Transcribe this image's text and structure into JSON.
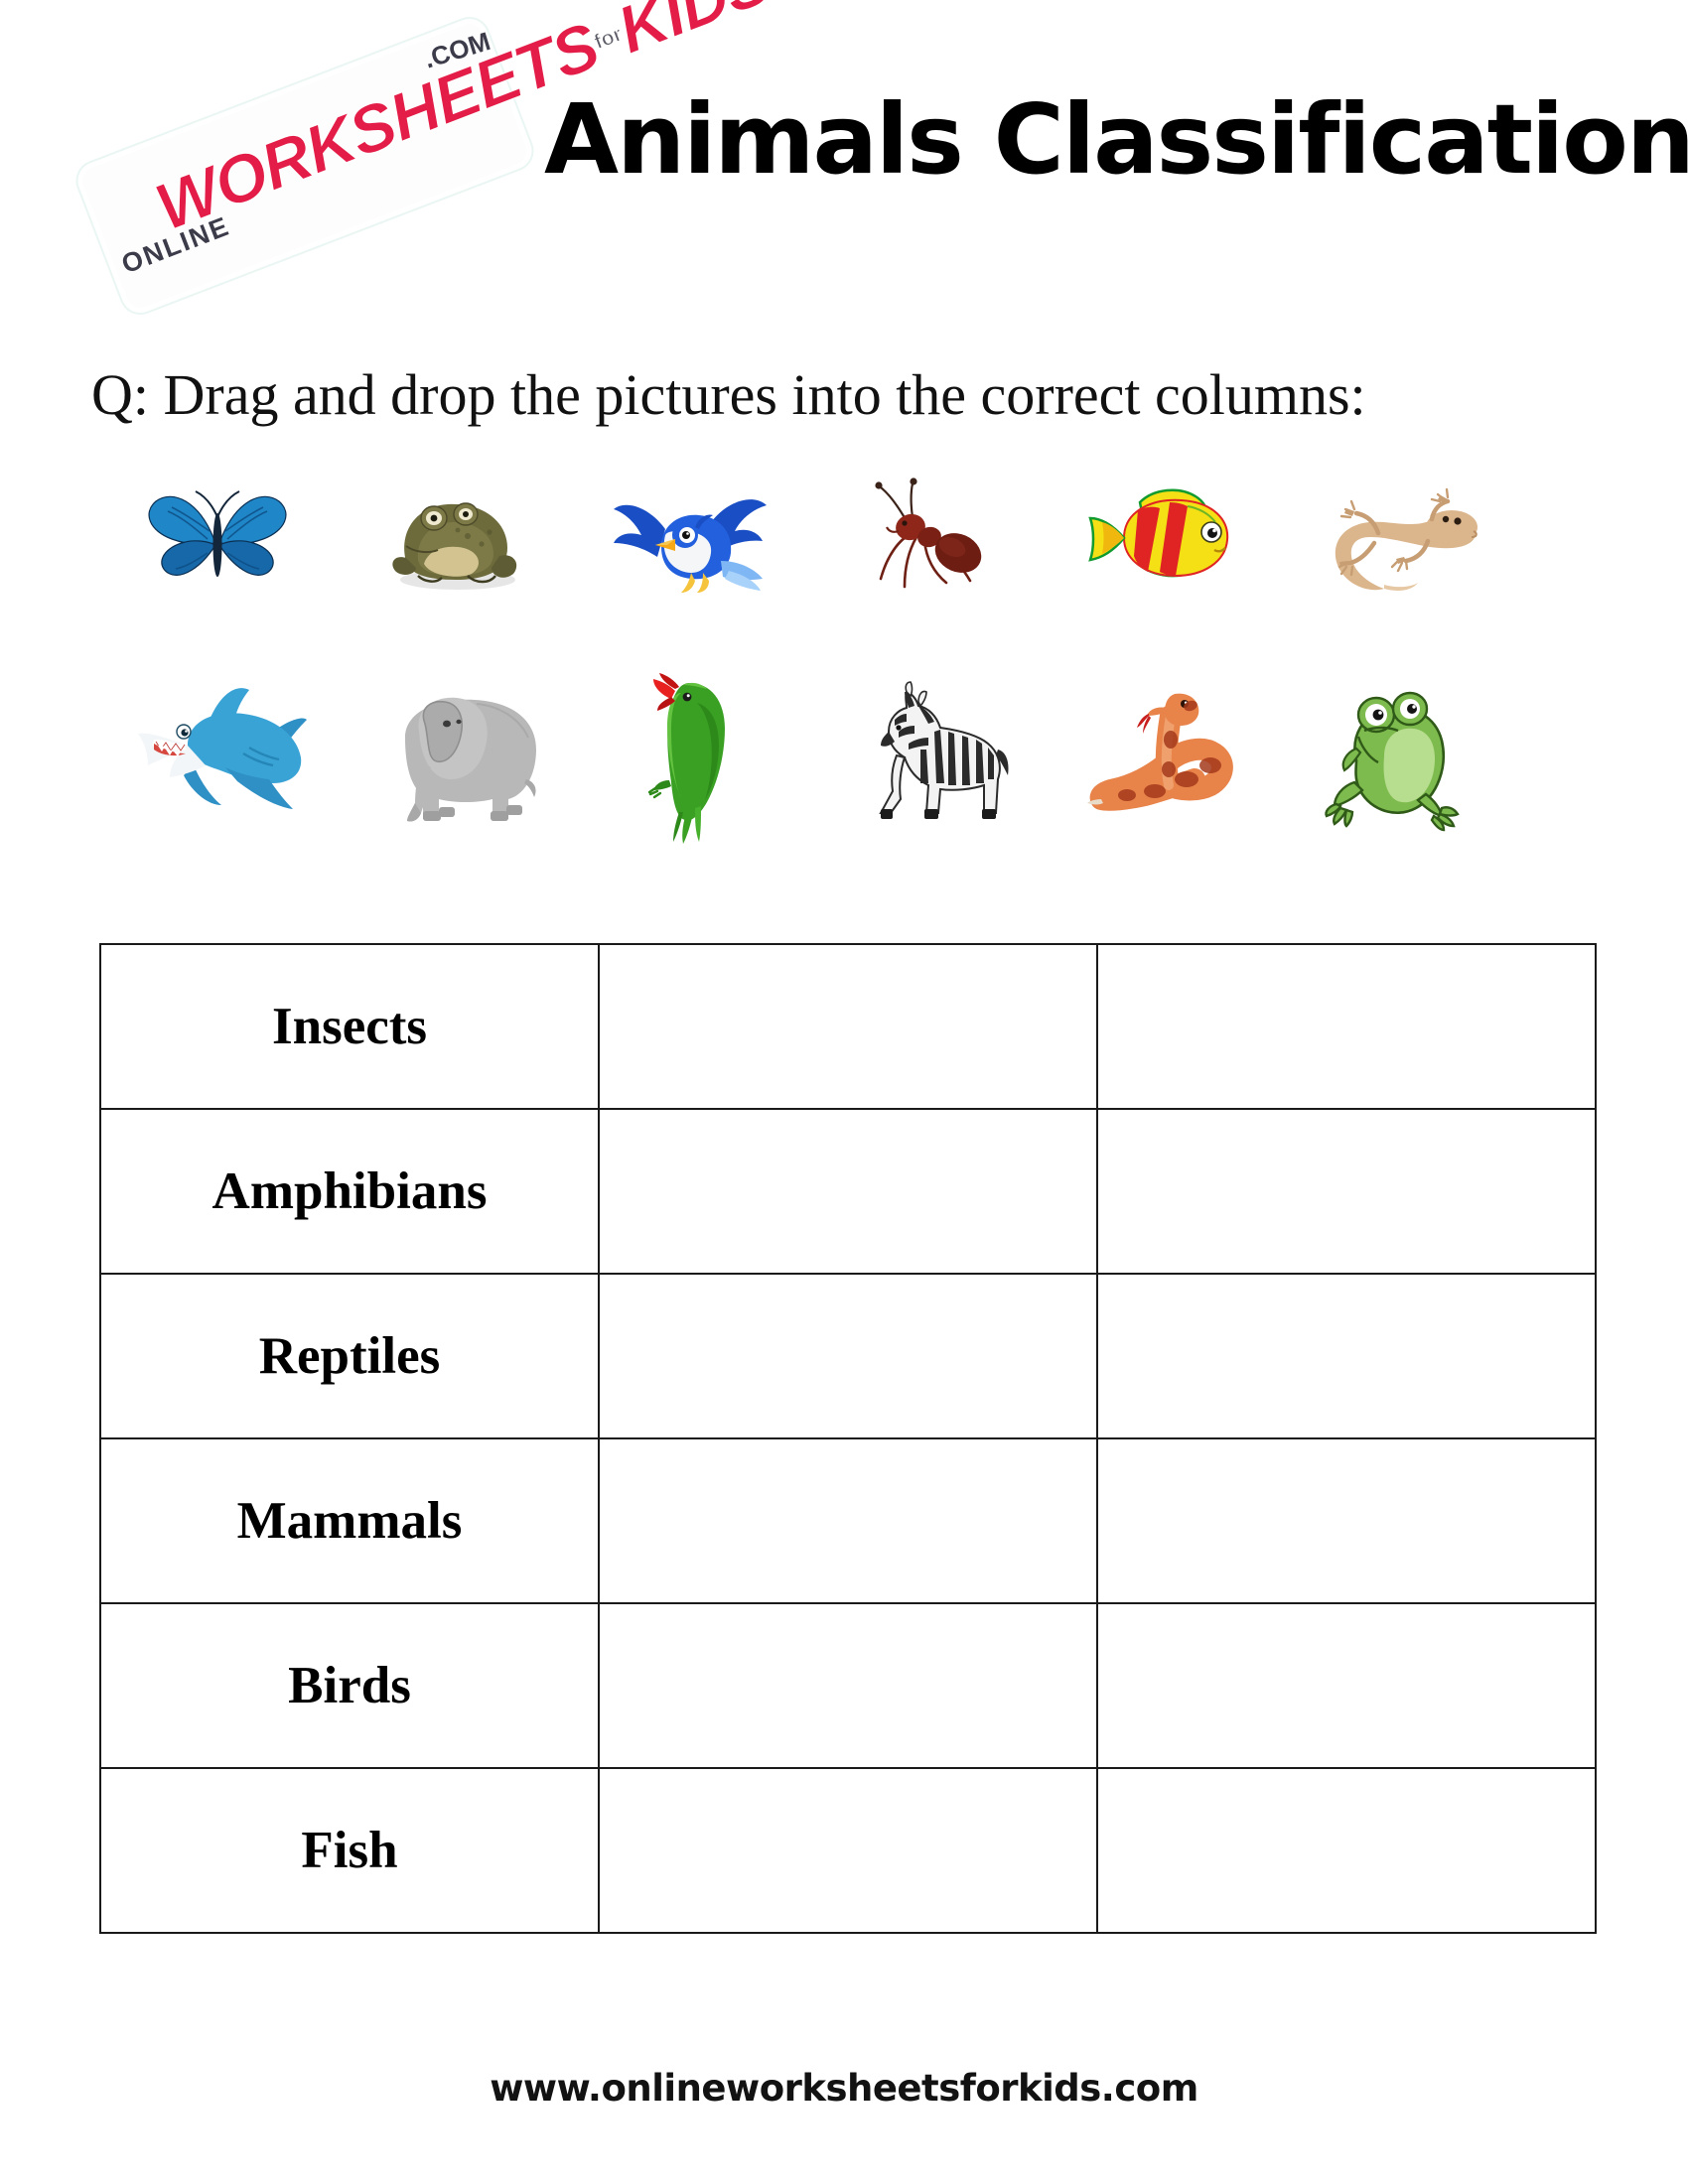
{
  "header": {
    "title": "Animals Classification",
    "logo": {
      "online": "ONLINE",
      "main": "WORKSHEETS",
      "for": "for",
      "kids": "KIDS",
      "com": ".COM",
      "accent_color": "#e31d47",
      "dark_color": "#3b3b4a"
    }
  },
  "question": "Q: Drag and drop the pictures into the correct columns:",
  "picture_bank": {
    "rows": [
      [
        {
          "name": "butterfly",
          "label": "Butterfly",
          "color": "#1f86c8"
        },
        {
          "name": "toad",
          "label": "Toad",
          "color": "#6d6b3c"
        },
        {
          "name": "bluebird",
          "label": "Blue bird",
          "color": "#1a4ec4"
        },
        {
          "name": "ant",
          "label": "Ant",
          "color": "#8e2719"
        },
        {
          "name": "clownfish",
          "label": "Fish",
          "color": "#f5e015"
        },
        {
          "name": "gecko",
          "label": "Lizard",
          "color": "#dbb58c"
        }
      ],
      [
        {
          "name": "shark",
          "label": "Shark",
          "color": "#3aa3d6"
        },
        {
          "name": "elephant",
          "label": "Elephant",
          "color": "#b8b8b8"
        },
        {
          "name": "parrot",
          "label": "Parrot",
          "color": "#3aa023"
        },
        {
          "name": "zebra",
          "label": "Zebra",
          "color": "#2b2b2b"
        },
        {
          "name": "snake",
          "label": "Snake",
          "color": "#e8834a"
        },
        {
          "name": "frog",
          "label": "Frog",
          "color": "#7ebb4e"
        }
      ]
    ]
  },
  "table": {
    "columns": 3,
    "categories": [
      "Insects",
      "Amphibians",
      "Reptiles",
      "Mammals",
      "Birds",
      "Fish"
    ],
    "answers": [
      "",
      "",
      "",
      "",
      "",
      "",
      "",
      "",
      "",
      "",
      "",
      ""
    ]
  },
  "footer": {
    "url": "www.onlineworksheetsforkids.com"
  }
}
